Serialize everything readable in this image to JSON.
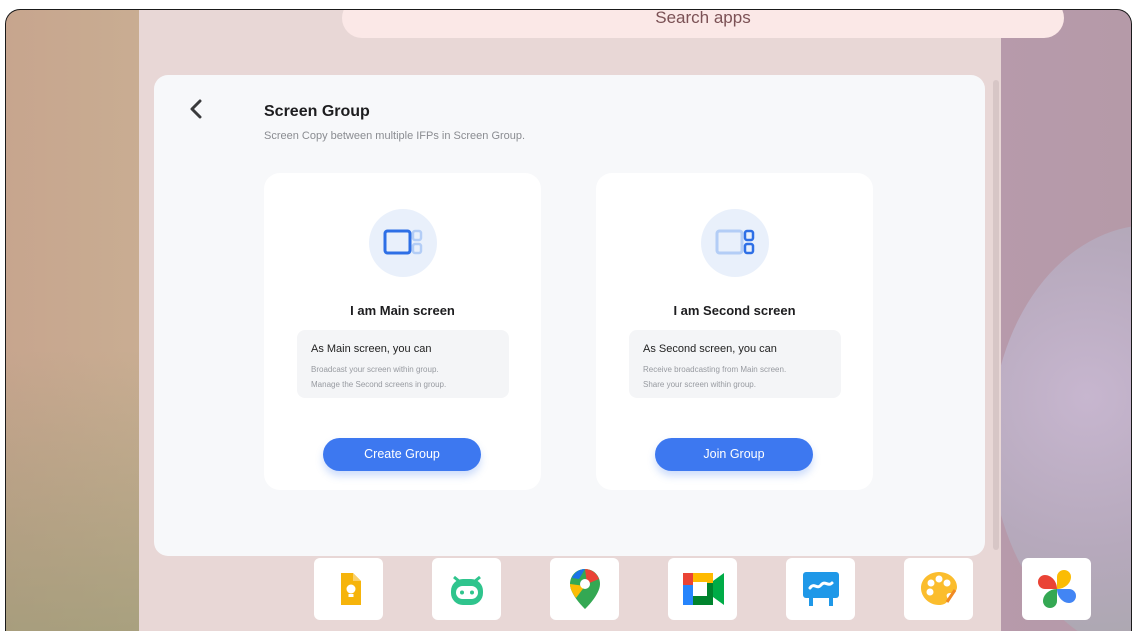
{
  "search": {
    "placeholder_text": "Search apps"
  },
  "dialog": {
    "title": "Screen Group",
    "subtitle": "Screen Copy between multiple IFPs in Screen Group."
  },
  "cards": [
    {
      "title": "I am Main screen",
      "info_head": "As Main screen, you can",
      "info_lines": [
        "Broadcast your screen within group.",
        "Manage the Second screens in group."
      ],
      "button": "Create Group",
      "icon": "main-screen-icon"
    },
    {
      "title": "I am Second screen",
      "info_head": "As Second screen, you can",
      "info_lines": [
        "Receive broadcasting from Main screen.",
        "Share your screen within group."
      ],
      "button": "Join Group",
      "icon": "second-screen-icon"
    }
  ],
  "dock_icons": [
    "keep-notes-icon",
    "robot-app-icon",
    "maps-icon",
    "meet-icon",
    "whiteboard-icon",
    "paint-palette-icon",
    "pinwheel-icon"
  ],
  "colors": {
    "accent": "#3d78f0",
    "icon_light": "#b3cdf6",
    "icon_dark": "#2e6fe6"
  }
}
